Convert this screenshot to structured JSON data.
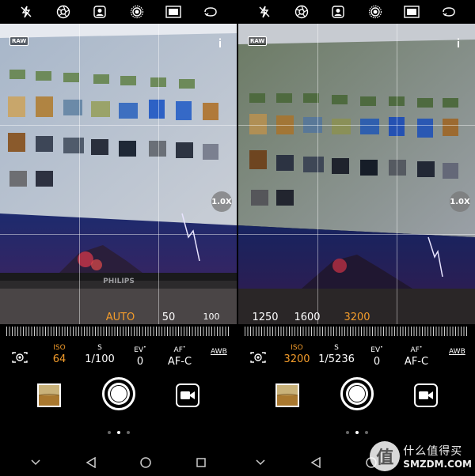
{
  "top_icons": [
    "flash-off-icon",
    "aperture-icon",
    "portrait-icon",
    "live-photo-icon",
    "film-icon",
    "switch-camera-icon"
  ],
  "left": {
    "raw_label": "RAW",
    "zoom": "1.0X",
    "scale": [
      {
        "label": "AUTO",
        "selected": true
      },
      {
        "label": "50",
        "selected": false
      },
      {
        "label": "100",
        "selected": false
      }
    ],
    "params": {
      "iso": {
        "label": "ISO",
        "value": "64"
      },
      "shutter": {
        "label": "S",
        "value": "1/100"
      },
      "ev": {
        "label": "EV",
        "value": "0"
      },
      "af": {
        "label": "AF",
        "value": "AF-C"
      },
      "wb": "AWB"
    }
  },
  "right": {
    "raw_label": "RAW",
    "zoom": "1.0X",
    "scale": [
      {
        "label": "1250",
        "selected": false
      },
      {
        "label": "1600",
        "selected": false
      },
      {
        "label": "3200",
        "selected": true
      }
    ],
    "params": {
      "iso": {
        "label": "ISO",
        "value": "3200"
      },
      "shutter": {
        "label": "S",
        "value": "1/5236"
      },
      "ev": {
        "label": "EV",
        "value": "0"
      },
      "af": {
        "label": "AF",
        "value": "AF-C"
      },
      "wb": "AWB"
    }
  },
  "monitor_brand": "PHILIPS",
  "watermark": {
    "cn": "什么值得买",
    "en": "SMZDM.COM",
    "logo_char": "值"
  },
  "colors": {
    "accent": "#f39c2b"
  }
}
